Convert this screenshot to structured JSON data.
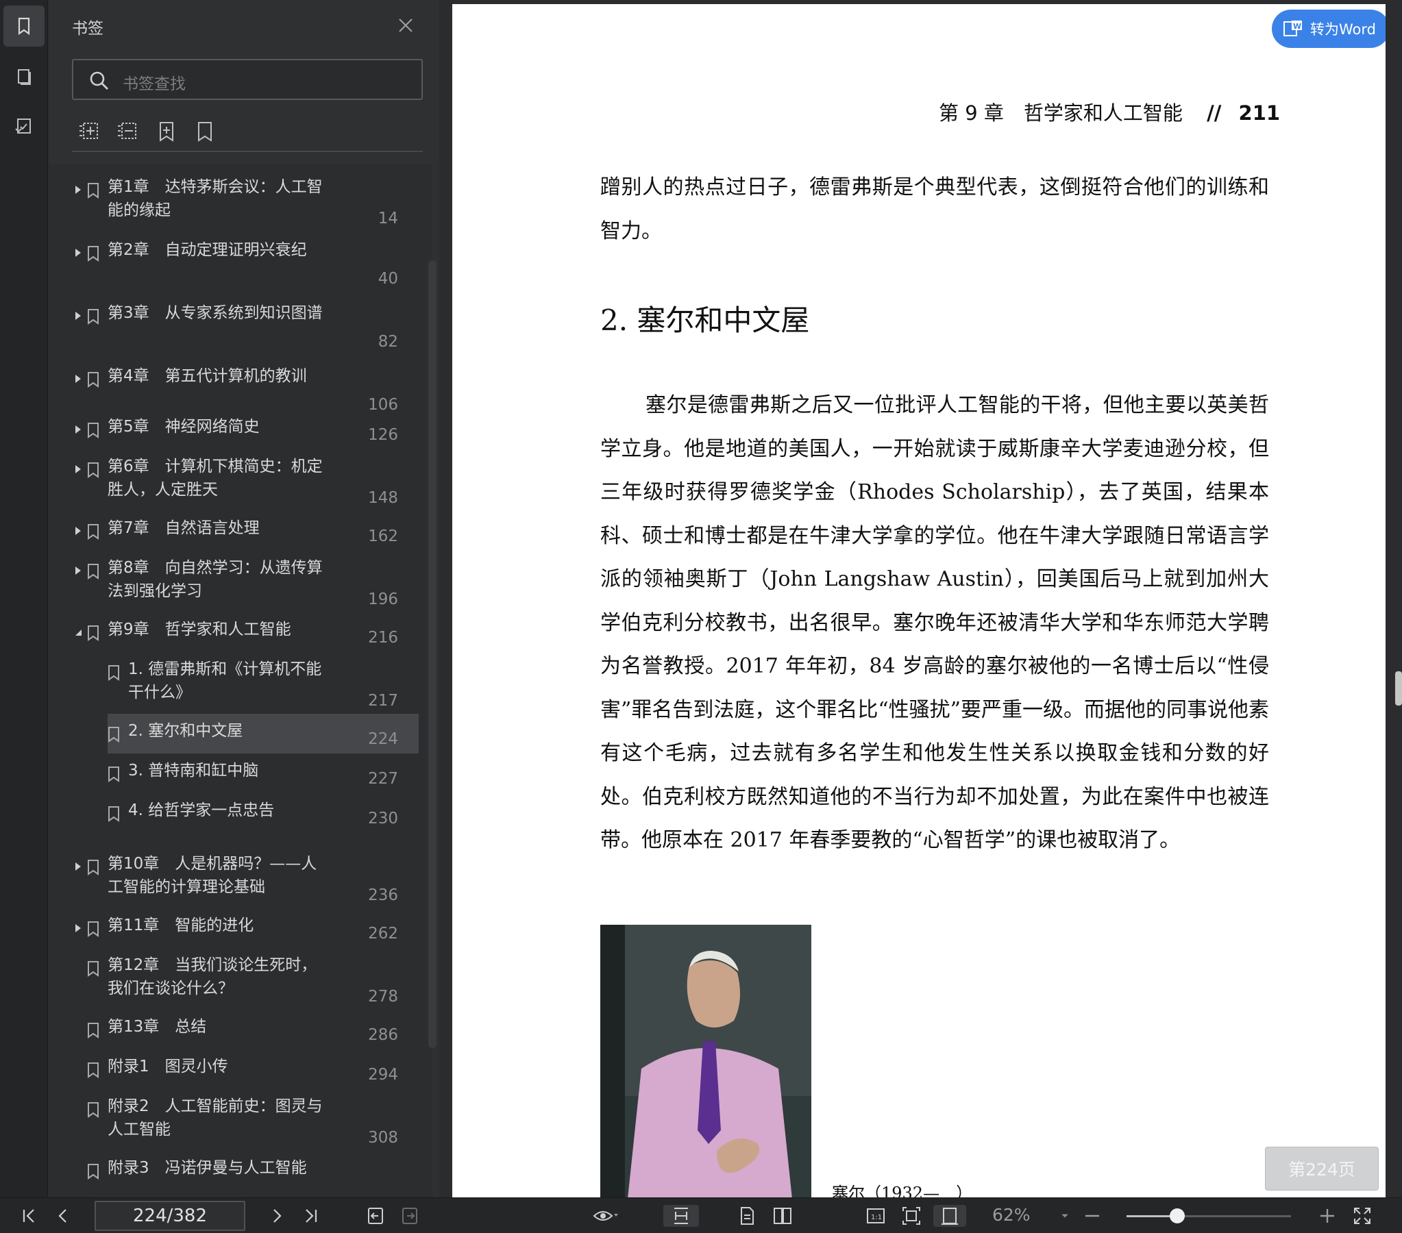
{
  "panel": {
    "title": "书签",
    "search_placeholder": "书签查找"
  },
  "bookmarks": [
    {
      "label": "第1章　达特茅斯会议：人工智\n能的缘起",
      "page": "14",
      "has_children": true,
      "expanded": false,
      "level": 0
    },
    {
      "label": "第2章　自动定理证明兴衰纪",
      "page": "40",
      "has_children": true,
      "expanded": false,
      "level": 0
    },
    {
      "label": "第3章　从专家系统到知识图谱",
      "page": "82",
      "has_children": true,
      "expanded": false,
      "level": 0
    },
    {
      "label": "第4章　第五代计算机的教训",
      "page": "106",
      "has_children": true,
      "expanded": false,
      "level": 0
    },
    {
      "label": "第5章　神经网络简史",
      "page": "126",
      "has_children": true,
      "expanded": false,
      "level": 0
    },
    {
      "label": "第6章　计算机下棋简史：机定\n胜人，人定胜天",
      "page": "148",
      "has_children": true,
      "expanded": false,
      "level": 0
    },
    {
      "label": "第7章　自然语言处理",
      "page": "162",
      "has_children": true,
      "expanded": false,
      "level": 0
    },
    {
      "label": "第8章　向自然学习：从遗传算\n法到强化学习",
      "page": "196",
      "has_children": true,
      "expanded": false,
      "level": 0
    },
    {
      "label": "第9章　哲学家和人工智能",
      "page": "216",
      "has_children": true,
      "expanded": true,
      "level": 0
    },
    {
      "label": "1. 德雷弗斯和《计算机不能\n干什么》",
      "page": "217",
      "has_children": false,
      "level": 1
    },
    {
      "label": "2. 塞尔和中文屋",
      "page": "224",
      "has_children": false,
      "level": 1,
      "selected": true
    },
    {
      "label": "3. 普特南和缸中脑",
      "page": "227",
      "has_children": false,
      "level": 1
    },
    {
      "label": "4. 给哲学家一点忠告",
      "page": "230",
      "has_children": false,
      "level": 1
    },
    {
      "label": "第10章　人是机器吗？——人\n工智能的计算理论基础",
      "page": "236",
      "has_children": true,
      "expanded": false,
      "level": 0
    },
    {
      "label": "第11章　智能的进化",
      "page": "262",
      "has_children": true,
      "expanded": false,
      "level": 0
    },
    {
      "label": "第12章　当我们谈论生死时，\n我们在谈论什么？",
      "page": "278",
      "has_children": false,
      "level": 0
    },
    {
      "label": "第13章　总结",
      "page": "286",
      "has_children": false,
      "level": 0
    },
    {
      "label": "附录1　图灵小传",
      "page": "294",
      "has_children": false,
      "level": 0
    },
    {
      "label": "附录2　人工智能前史：图灵与\n人工智能",
      "page": "308",
      "has_children": false,
      "level": 0
    },
    {
      "label": "附录3　冯诺伊曼与人工智能",
      "page": "",
      "has_children": false,
      "level": 0
    }
  ],
  "document": {
    "running_head": "第 9 章　哲学家和人工智能",
    "running_sep": "//",
    "running_page": "211",
    "para1": "蹭别人的热点过日子，德雷弗斯是个典型代表，这倒挺符合他们的训练和智力。",
    "section_title": "2. 塞尔和中文屋",
    "para2": "塞尔是德雷弗斯之后又一位批评人工智能的干将，但他主要以英美哲学立身。他是地道的美国人，一开始就读于威斯康辛大学麦迪逊分校，但三年级时获得罗德奖学金（Rhodes Scholarship），去了英国，结果本科、硕士和博士都是在牛津大学拿的学位。他在牛津大学跟随日常语言学派的领袖奥斯丁（John Langshaw Austin），回美国后马上就到加州大学伯克利分校教书，出名很早。塞尔晚年还被清华大学和华东师范大学聘为名誉教授。2017 年年初，84 岁高龄的塞尔被他的一名博士后以“性侵害”罪名告到法庭，这个罪名比“性骚扰”要严重一级。而据他的同事说他素有这个毛病，过去就有多名学生和他发生性关系以换取金钱和分数的好处。伯克利校方既然知道他的不当行为却不加处置，为此在案件中也被连带。他原本在 2017 年春季要教的“心智哲学”的课也被取消了。",
    "caption": "塞尔（1932—　）"
  },
  "convert_button": "转为Word",
  "page_indicator": "第224页",
  "toolbar": {
    "page_value": "224/382",
    "zoom": "62%",
    "zoom_level_fraction": 0.31
  }
}
